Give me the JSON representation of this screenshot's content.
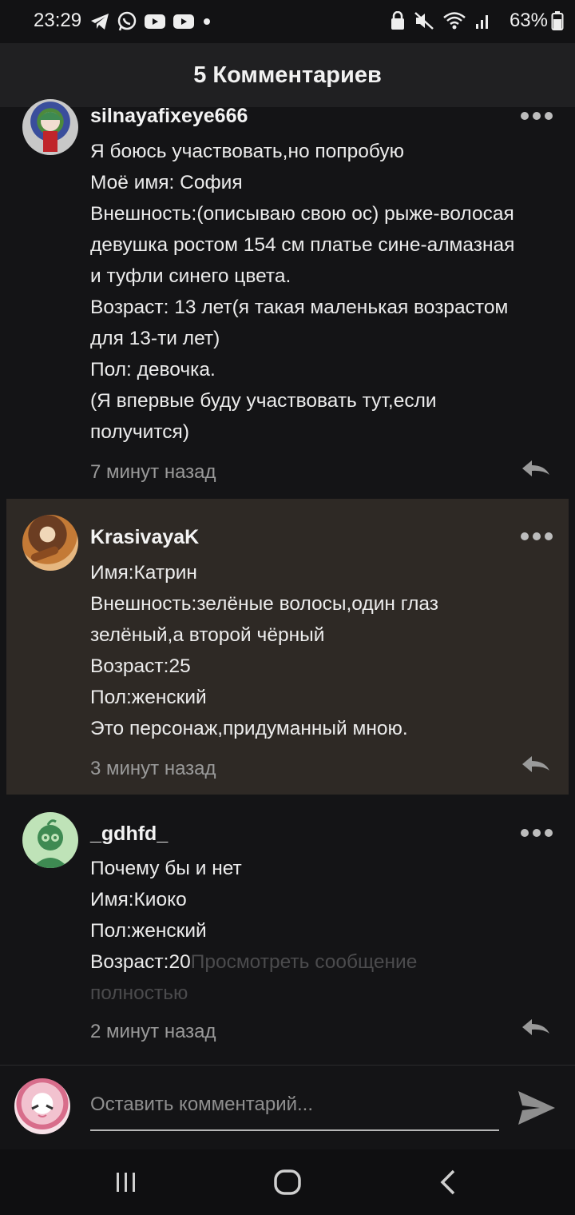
{
  "status_bar": {
    "time": "23:29",
    "battery": "63%"
  },
  "header": {
    "title": "5 Комментариев"
  },
  "comments": [
    {
      "username": "silnayafixeye666",
      "lines": [
        "Я боюсь участвовать,но попробую",
        "Моё имя: София",
        "Внешность:(описываю свою ос) рыже-волосая",
        "девушка ростом 154 см платье сине-алмазная",
        "и туфли синего цвета.",
        "Возраст: 13 лет(я такая маленькая возрастом",
        "для 13-ти лет)",
        "Пол: девочка.",
        "(Я впервые буду участвовать тут,если",
        "получится)"
      ],
      "time": "7 минут назад"
    },
    {
      "username": "KrasivayaK",
      "lines": [
        "Имя:Катрин",
        "Внешность:зелёные волосы,один глаз",
        "зелёный,а второй чёрный",
        "Возраст:25",
        "Пол:женский",
        "Это персонаж,придуманный мною."
      ],
      "time": "3 минут назад"
    },
    {
      "username": "_gdhfd_",
      "lines": [
        "Почему бы и нет",
        "Имя:Киоко",
        "Пол:женский"
      ],
      "last_line_text": "Возраст:20",
      "view_more": "Просмотреть сообщение",
      "view_more_cont": "полностью",
      "time": "2 минут назад"
    }
  ],
  "composer": {
    "placeholder": "Оставить комментарий..."
  },
  "icons": {
    "more": "more-horizontal-icon",
    "reply": "reply-icon",
    "send": "send-icon",
    "nav_recent": "recent-apps-icon",
    "nav_home": "home-icon",
    "nav_back": "back-icon"
  },
  "colors": {
    "background": "#141416",
    "header": "#202022",
    "highlight": "#2e2925",
    "text": "#ececec",
    "muted": "#9a9a9a"
  }
}
